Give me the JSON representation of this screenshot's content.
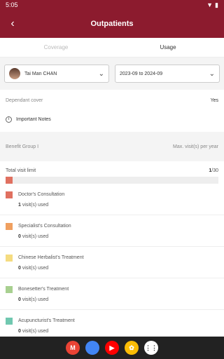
{
  "status_bar": {
    "time": "5:05"
  },
  "app_bar": {
    "title": "Outpatients"
  },
  "tabs": [
    {
      "label": "Coverage"
    },
    {
      "label": "Usage"
    }
  ],
  "filters": {
    "member": "Tai Man CHAN",
    "period": "2023-09 to 2024-09"
  },
  "info": {
    "dependant_label": "Dependant cover",
    "dependant_value": "Yes",
    "notes_label": "Important Notes"
  },
  "group": {
    "label": "Benefit Group I",
    "note": "Max. visit(s) per year"
  },
  "visit_limit": {
    "label": "Total visit limit",
    "used": "1",
    "total": "/30",
    "fraction": 0.0333
  },
  "services": [
    {
      "name": "Doctor's Consultation",
      "count": "1",
      "used_label": "visit(s) used",
      "color": "#e07060"
    },
    {
      "name": "Specialist's Consultation",
      "count": "0",
      "used_label": "visit(s) used",
      "color": "#f0a060"
    },
    {
      "name": "Chinese Herbalist's Treatment",
      "count": "0",
      "used_label": "visit(s) used",
      "color": "#f5dc80"
    },
    {
      "name": "Bonesetter's Treatment",
      "count": "0",
      "used_label": "visit(s) used",
      "color": "#a8d090"
    },
    {
      "name": "Acupuncturist's Treatment",
      "count": "0",
      "used_label": "visit(s) used",
      "color": "#70c8b0"
    }
  ],
  "dock_apps": [
    {
      "icon": "gmail-icon",
      "glyph": "M",
      "color": "#ea4335"
    },
    {
      "icon": "chrome-icon",
      "glyph": "",
      "color": "#4285f4"
    },
    {
      "icon": "youtube-icon",
      "glyph": "▶",
      "color": "#ff0000"
    },
    {
      "icon": "photos-icon",
      "glyph": "✿",
      "color": "#fbbc05"
    },
    {
      "icon": "apps-icon",
      "glyph": "⋮⋮",
      "color": "#ffffff"
    }
  ],
  "colors": {
    "brand": "#8c1b2e"
  }
}
